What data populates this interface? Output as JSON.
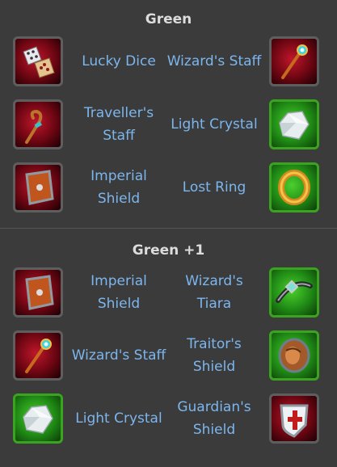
{
  "sections": [
    {
      "title": "Green",
      "rows": [
        {
          "left": {
            "name": "Lucky Dice",
            "icon": "dice-icon"
          },
          "right": {
            "name": "Wizard's Staff",
            "icon": "wizard-staff-icon"
          }
        },
        {
          "left": {
            "name": "Traveller's\nStaff",
            "icon": "traveller-staff-icon"
          },
          "right": {
            "name": "Light Crystal",
            "icon": "crystal-icon"
          }
        },
        {
          "left": {
            "name": "Imperial\nShield",
            "icon": "imperial-shield-icon"
          },
          "right": {
            "name": "Lost Ring",
            "icon": "ring-icon"
          }
        }
      ]
    },
    {
      "title": "Green +1",
      "rows": [
        {
          "left": {
            "name": "Imperial\nShield",
            "icon": "imperial-shield-icon"
          },
          "right": {
            "name": "Wizard's\nTiara",
            "icon": "tiara-icon"
          }
        },
        {
          "left": {
            "name": "Wizard's Staff",
            "icon": "wizard-staff-icon"
          },
          "right": {
            "name": "Traitor's\nShield",
            "icon": "traitor-shield-icon"
          }
        },
        {
          "left": {
            "name": "Light Crystal",
            "icon": "crystal-icon"
          },
          "right": {
            "name": "Guardian's\nShield",
            "icon": "guardian-shield-icon"
          }
        }
      ]
    }
  ],
  "colors": {
    "background": "#3b3b3b",
    "item_text": "#7cb6ee",
    "title_text": "#dcdcdc",
    "rarity_green": "#3aa31f",
    "frame_red": "#c0162a"
  }
}
